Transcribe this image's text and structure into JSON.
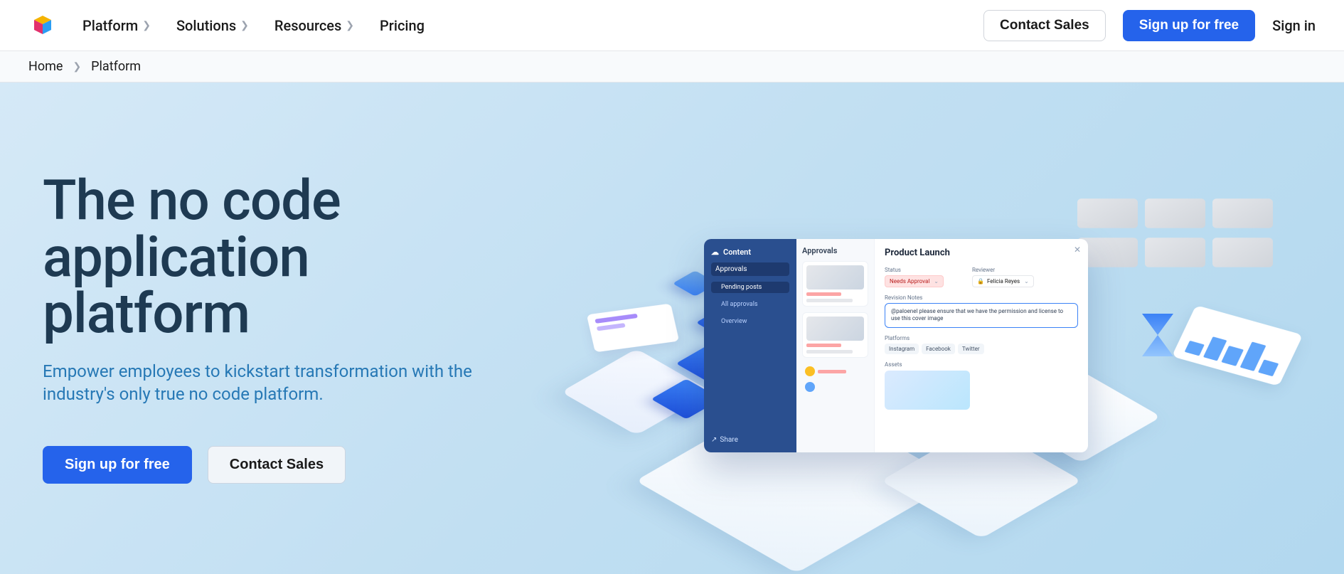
{
  "nav": {
    "items": [
      {
        "label": "Platform",
        "has_menu": true
      },
      {
        "label": "Solutions",
        "has_menu": true
      },
      {
        "label": "Resources",
        "has_menu": true
      },
      {
        "label": "Pricing",
        "has_menu": false
      }
    ],
    "contact_label": "Contact Sales",
    "signup_label": "Sign up for free",
    "signin_label": "Sign in"
  },
  "breadcrumb": {
    "home_label": "Home",
    "current_label": "Platform"
  },
  "hero": {
    "title": "The no code application platform",
    "subtitle": "Empower employees to kickstart transformation with the industry's only true no code platform.",
    "primary_cta": "Sign up for free",
    "secondary_cta": "Contact Sales"
  },
  "mock": {
    "sidebar_title": "Content",
    "sidebar_items": {
      "approvals": "Approvals",
      "pending": "Pending posts",
      "all": "All approvals",
      "overview": "Overview"
    },
    "share_label": "Share",
    "mid_title": "Approvals",
    "panel_title": "Product Launch",
    "status_label": "Status",
    "status_value": "Needs Approval",
    "reviewer_label": "Reviewer",
    "reviewer_value": "Felicia Reyes",
    "notes_label": "Revision Notes",
    "notes_value": "@paloenel please ensure that we have the permission and license to use this cover image",
    "platforms_label": "Platforms",
    "platforms": [
      "Instagram",
      "Facebook",
      "Twitter"
    ],
    "assets_label": "Assets"
  }
}
